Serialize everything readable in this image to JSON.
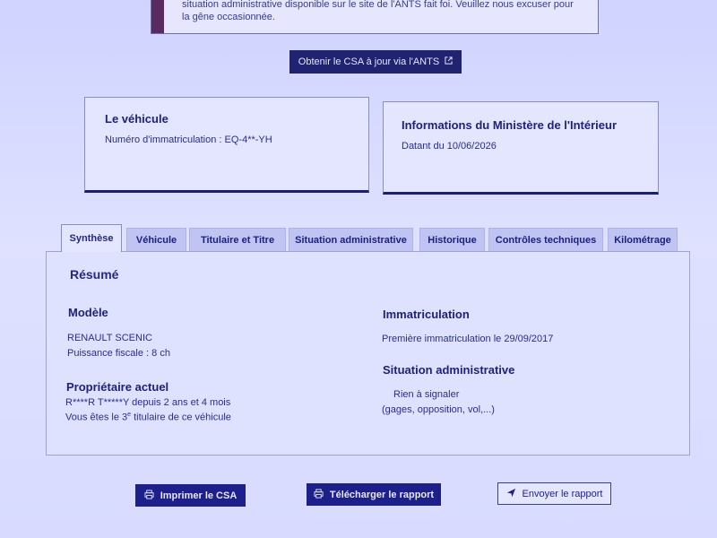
{
  "notice": {
    "line1": "situation administrative disponible sur le site de l'ANTS fait foi. Veuillez nous excuser pour",
    "line2": "la gêne occasionnée."
  },
  "csa_button": {
    "label": "Obtenir le CSA à jour via l'ANTS",
    "icon": "external-link-icon"
  },
  "vehicle_card": {
    "title": "Le véhicule",
    "plate_label": "Numéro d'immatriculation : EQ-4**-YH"
  },
  "ministry_card": {
    "title": "Informations du Ministère de l'Intérieur",
    "date": "Datant du 10/06/2026"
  },
  "tabs": [
    {
      "label": "Synthèse",
      "active": true
    },
    {
      "label": "Véhicule"
    },
    {
      "label": "Titulaire et Titre"
    },
    {
      "label": "Situation administrative"
    },
    {
      "label": "Historique"
    },
    {
      "label": "Contrôles techniques"
    },
    {
      "label": "Kilométrage"
    }
  ],
  "summary": {
    "title": "Résumé",
    "model_heading": "Modèle",
    "model": "RENAULT SCENIC",
    "fiscal_power": "Puissance fiscale : 8 ch",
    "owner_heading": "Propriétaire actuel",
    "owner": "R****R T*****Y depuis 2 ans et 4 mois",
    "owner_rank_pre": "Vous êtes le 3",
    "owner_rank_sup": "e",
    "owner_rank_post": " titulaire de ce véhicule",
    "registration_heading": "Immatriculation",
    "first_registration_label": "Première immatriculation le ",
    "first_registration_date": "29/09/2017",
    "admin_heading": "Situation administrative",
    "admin_status": "Rien à signaler",
    "admin_detail": "(gages, opposition, vol,...)"
  },
  "actions": {
    "print_label": "Imprimer le CSA",
    "download_label": "Télécharger le rapport",
    "send_label": "Envoyer le rapport"
  }
}
